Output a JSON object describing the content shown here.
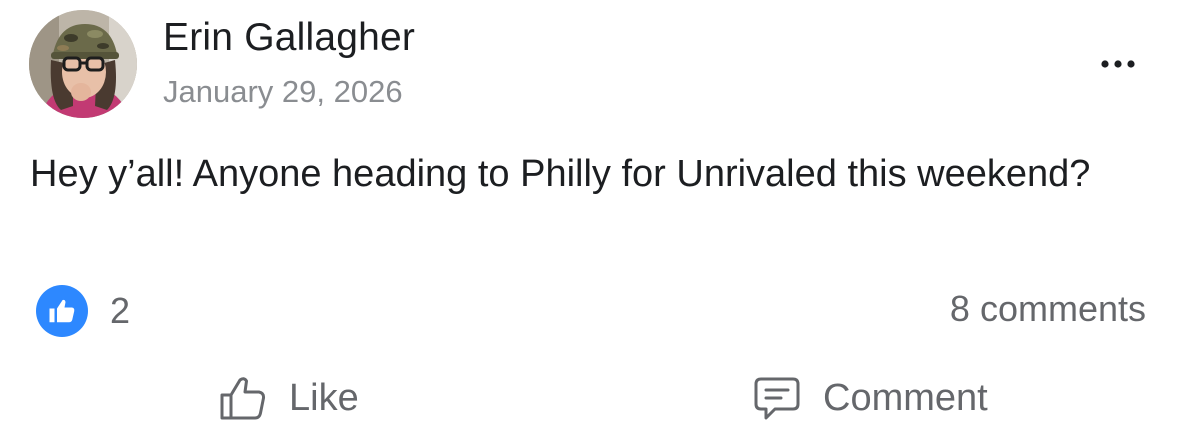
{
  "post": {
    "author": "Erin Gallagher",
    "date": "January 29, 2026",
    "text": "Hey y’all! Anyone heading to Philly for Unrivaled this weekend?",
    "reactions": {
      "count": "2",
      "type_icon": "thumbs-up-icon"
    },
    "comments_label": "8 comments",
    "actions": {
      "like_label": "Like",
      "comment_label": "Comment"
    }
  },
  "colors": {
    "like_blue": "#2d88ff",
    "secondary_text": "#65676b",
    "date_text": "#8a8d91",
    "primary_text": "#1c1e21"
  },
  "icons": {
    "more": "more-horizontal-icon",
    "like": "thumbs-up-outline-icon",
    "comment": "comment-bubble-icon"
  }
}
